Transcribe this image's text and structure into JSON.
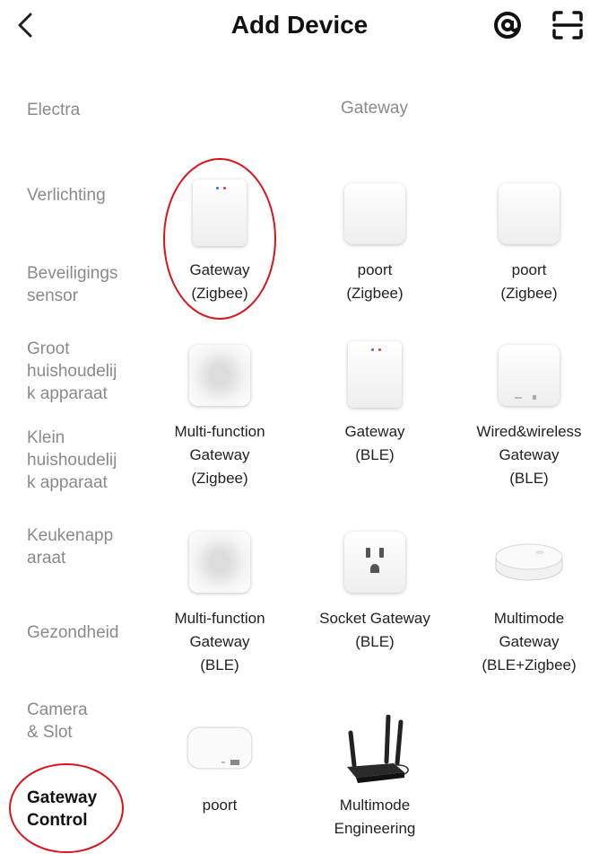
{
  "header": {
    "title": "Add Device"
  },
  "sidebar": {
    "items": [
      {
        "label": "Electra"
      },
      {
        "label": "Verlichting"
      },
      {
        "label": "Beveiligings\nsensor"
      },
      {
        "label": "Groot\nhuishoudelij\nk apparaat"
      },
      {
        "label": "Klein\nhuishoudelij\nk apparaat"
      },
      {
        "label": "Keukenapp\naraat"
      },
      {
        "label": "Gezondheid"
      },
      {
        "label": "Camera\n& Slot"
      },
      {
        "label": "Gateway\nControl",
        "selected": true
      }
    ]
  },
  "main": {
    "section_title": "Gateway",
    "devices": [
      {
        "label": "Gateway\n(Zigbee)",
        "icon": "gateway-hub-icon"
      },
      {
        "label": "poort\n(Zigbee)",
        "icon": "square-hub-icon"
      },
      {
        "label": "poort\n(Zigbee)",
        "icon": "square-hub-icon"
      },
      {
        "label": "Multi-function\nGateway\n(Zigbee)",
        "icon": "mesh-gateway-icon"
      },
      {
        "label": "Gateway\n(BLE)",
        "icon": "gateway-hub-icon"
      },
      {
        "label": "Wired&wireless\nGateway\n(BLE)",
        "icon": "wired-gateway-icon"
      },
      {
        "label": "Multi-function\nGateway\n(BLE)",
        "icon": "mesh-gateway-icon"
      },
      {
        "label": "Socket Gateway\n(BLE)",
        "icon": "socket-icon"
      },
      {
        "label": "Multimode\nGateway\n(BLE+Zigbee)",
        "icon": "round-hub-icon"
      },
      {
        "label": "poort",
        "icon": "flat-hub-icon"
      },
      {
        "label": "Multimode\nEngineering",
        "icon": "router-antenna-icon"
      }
    ]
  },
  "colors": {
    "annotation_circle": "#d9141b",
    "inactive_text": "#8a8a8a",
    "active_text": "#111111"
  }
}
